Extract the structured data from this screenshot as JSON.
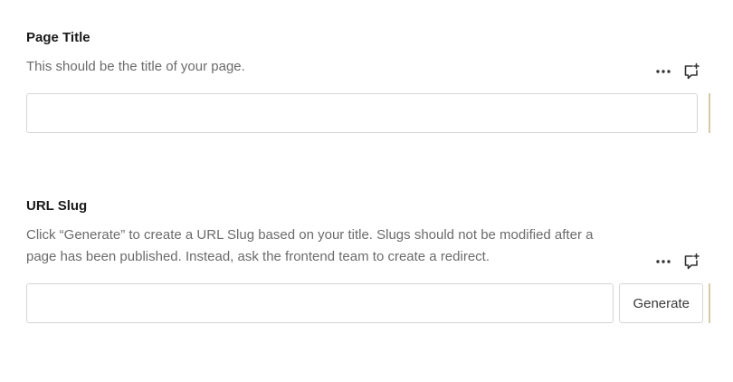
{
  "fields": {
    "title": {
      "label": "Page Title",
      "description": "This should be the title of your page.",
      "value": "",
      "placeholder": ""
    },
    "slug": {
      "label": "URL Slug",
      "description": "Click “Generate” to create a URL Slug based on your title. Slugs should not be modified after a page has been published. Instead, ask the frontend team to create a redirect.",
      "value": "",
      "placeholder": "",
      "generate_label": "Generate"
    }
  },
  "icons": {
    "more": "more-horizontal-icon",
    "comment": "comment-add-icon"
  },
  "colors": {
    "label": "#1a1a1a",
    "description": "#6b6b6b",
    "border": "#d5d5d5",
    "edge_accent": "#d9c9a6"
  }
}
